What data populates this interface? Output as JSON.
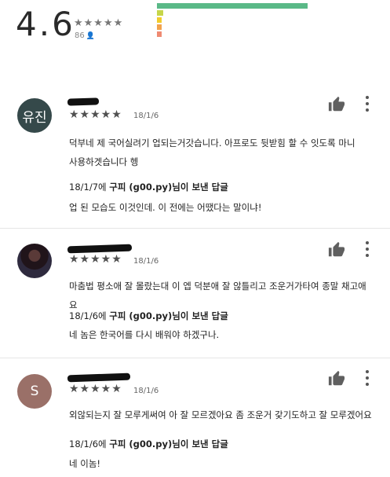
{
  "summary": {
    "average": "4.6",
    "stars": "★★★★★",
    "count": "86",
    "bar_colors": [
      "#5ab987",
      "#c6d64a",
      "#f1cc2c",
      "#f2a34c",
      "#ef8a72"
    ],
    "bar_levels": [
      1.0,
      0.04,
      0.02,
      0.015,
      0.01
    ]
  },
  "reviews": [
    {
      "avatar_text": "유진",
      "avatar_color": "#35494a",
      "stars": "★★★★★",
      "date": "18/1/6",
      "body_lines": [
        "덕부네 제 국어실려기 업되는거갓습니다. 아프로도 뒷받힘 할 수 잇도록 마니",
        "사용하겟습니다 헹"
      ],
      "reply_date": "18/1/7에",
      "reply_author": "구피 (g00.py)",
      "reply_suffix": "님이 보낸 답글",
      "reply_text": "업 된 모습도 이것인데. 이 전에는 어땠다는 말이냐!"
    },
    {
      "avatar_text": "",
      "avatar_color": "#2b2233",
      "stars": "★★★★★",
      "date": "18/1/6",
      "body_lines": [
        "마춤법 평소애 잘 몰랐는대 이 엡 덕분애 잘 않틀리고 조운거가타여 종말 채고애요"
      ],
      "reply_date": "18/1/6에",
      "reply_author": "구피 (g00.py)",
      "reply_suffix": "님이 보낸 답글",
      "reply_text": "네 놈은 한국어를 다시 배워야 하겠구나."
    },
    {
      "avatar_text": "S",
      "avatar_color": "#9a7068",
      "stars": "★★★★★",
      "date": "18/1/6",
      "body_lines": [
        "외않되는지 잘 모루게써여 아 잘 모르겠아요 좀 조운거 갗기도하고 잘 모루겠어요"
      ],
      "reply_date": "18/1/6에",
      "reply_author": "구피 (g00.py)",
      "reply_suffix": "님이 보낸 답글",
      "reply_text": "네 이놈!"
    }
  ]
}
